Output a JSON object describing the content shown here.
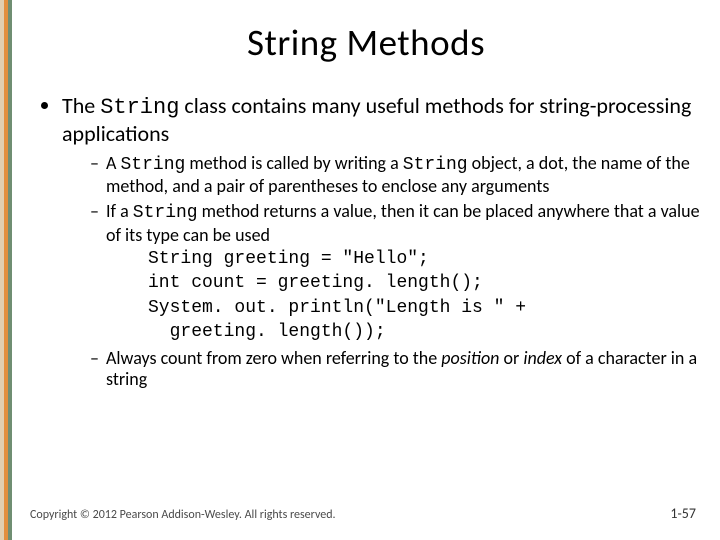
{
  "title": "String Methods",
  "bullet1_pre": "The ",
  "bullet1_code": "String",
  "bullet1_post": " class contains many useful methods for string-processing applications",
  "sub1_a": "A ",
  "sub1_b": "String",
  "sub1_c": " method is called by writing a ",
  "sub1_d": "String",
  "sub1_e": " object, a dot, the name of the method, and a pair of parentheses to enclose any arguments",
  "sub2_a": "If a ",
  "sub2_b": "String",
  "sub2_c": " method returns a value, then it can be placed anywhere that a value of its type can be used",
  "code_line1": "String greeting = \"Hello\";",
  "code_line2": "int count = greeting. length();",
  "code_line3": "System. out. println(\"Length is \" +",
  "code_line4": "  greeting. length());",
  "sub3_a": "Always count from zero when referring to the ",
  "sub3_b": "position",
  "sub3_c": " or ",
  "sub3_d": "index",
  "sub3_e": " of a character in a string",
  "copyright": "Copyright © 2012 Pearson Addison-Wesley. All rights reserved.",
  "page_number": "1-57"
}
